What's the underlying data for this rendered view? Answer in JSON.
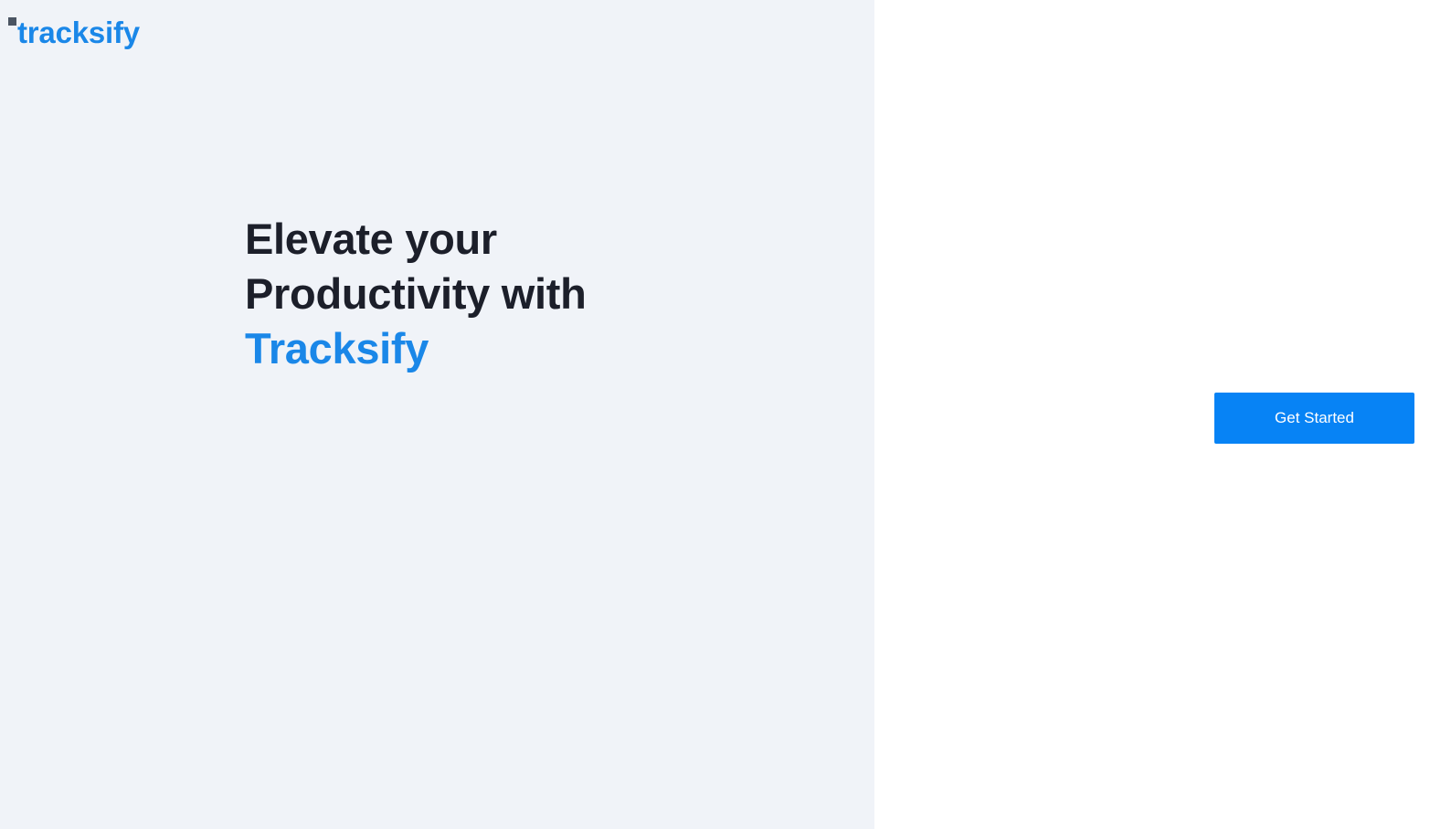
{
  "brand": {
    "logo_text": "tracksify",
    "accent_color": "#1a87e8"
  },
  "hero": {
    "line1": "Elevate your",
    "line2": "Productivity with",
    "line3": "Tracksify",
    "text_color": "#1c1f2a"
  },
  "actions": {
    "get_started_label": "Get Started",
    "button_color": "#0783f5"
  },
  "theme": {
    "left_panel_bg": "#f0f3f8",
    "right_panel_bg": "#ffffff"
  }
}
